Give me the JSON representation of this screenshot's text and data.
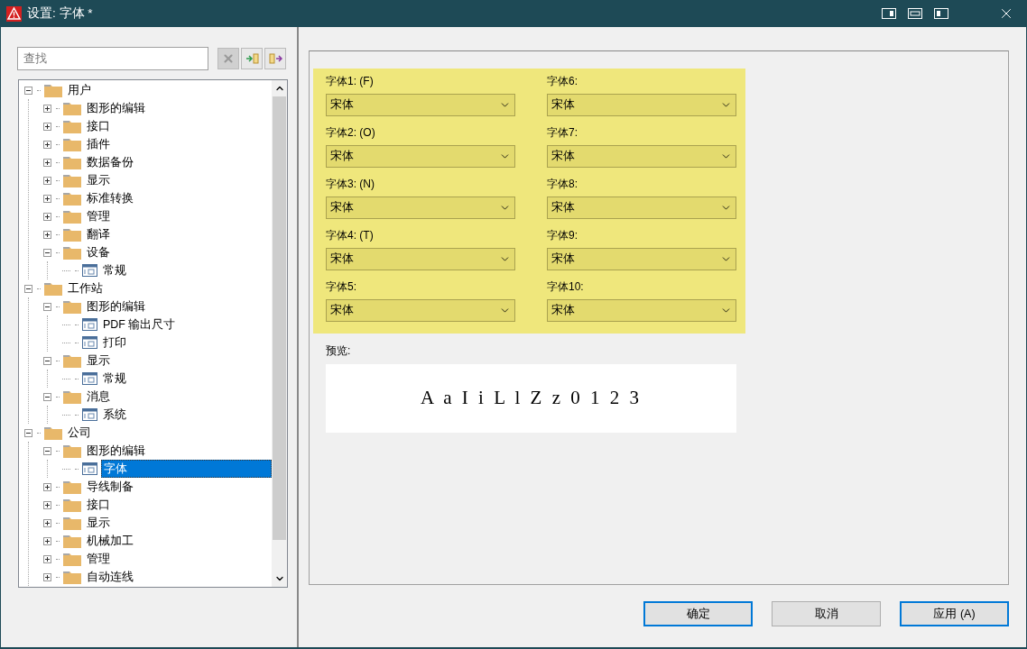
{
  "window": {
    "title": "设置: 字体 *"
  },
  "search": {
    "placeholder": "查找"
  },
  "tree": [
    {
      "label": "用户",
      "kind": "folder",
      "expanded": true,
      "selected": false,
      "children": [
        {
          "label": "图形的编辑",
          "kind": "folder",
          "expanded": false,
          "selected": false
        },
        {
          "label": "接口",
          "kind": "folder",
          "expanded": false,
          "selected": false
        },
        {
          "label": "插件",
          "kind": "folder",
          "expanded": false,
          "selected": false
        },
        {
          "label": "数据备份",
          "kind": "folder",
          "expanded": false,
          "selected": false
        },
        {
          "label": "显示",
          "kind": "folder",
          "expanded": false,
          "selected": false
        },
        {
          "label": "标准转换",
          "kind": "folder",
          "expanded": false,
          "selected": false
        },
        {
          "label": "管理",
          "kind": "folder",
          "expanded": false,
          "selected": false
        },
        {
          "label": "翻译",
          "kind": "folder",
          "expanded": false,
          "selected": false
        },
        {
          "label": "设备",
          "kind": "folder",
          "expanded": true,
          "selected": false,
          "children": [
            {
              "label": "常规",
              "kind": "page",
              "selected": false
            }
          ]
        }
      ]
    },
    {
      "label": "工作站",
      "kind": "folder",
      "expanded": true,
      "selected": false,
      "children": [
        {
          "label": "图形的编辑",
          "kind": "folder",
          "expanded": true,
          "selected": false,
          "children": [
            {
              "label": "PDF 输出尺寸",
              "kind": "page",
              "selected": false
            },
            {
              "label": "打印",
              "kind": "page",
              "selected": false
            }
          ]
        },
        {
          "label": "显示",
          "kind": "folder",
          "expanded": true,
          "selected": false,
          "children": [
            {
              "label": "常规",
              "kind": "page",
              "selected": false
            }
          ]
        },
        {
          "label": "消息",
          "kind": "folder",
          "expanded": true,
          "selected": false,
          "children": [
            {
              "label": "系统",
              "kind": "page",
              "selected": false
            }
          ]
        }
      ]
    },
    {
      "label": "公司",
      "kind": "folder",
      "expanded": true,
      "selected": false,
      "children": [
        {
          "label": "图形的编辑",
          "kind": "folder",
          "expanded": true,
          "selected": false,
          "children": [
            {
              "label": "字体",
              "kind": "page",
              "selected": true
            }
          ]
        },
        {
          "label": "导线制备",
          "kind": "folder",
          "expanded": false,
          "selected": false
        },
        {
          "label": "接口",
          "kind": "folder",
          "expanded": false,
          "selected": false
        },
        {
          "label": "显示",
          "kind": "folder",
          "expanded": false,
          "selected": false
        },
        {
          "label": "机械加工",
          "kind": "folder",
          "expanded": false,
          "selected": false
        },
        {
          "label": "管理",
          "kind": "folder",
          "expanded": false,
          "selected": false
        },
        {
          "label": "自动连线",
          "kind": "folder",
          "expanded": false,
          "selected": false
        }
      ]
    }
  ],
  "fonts": [
    {
      "label": "字体1: (F)",
      "value": "宋体"
    },
    {
      "label": "字体2: (O)",
      "value": "宋体"
    },
    {
      "label": "字体3: (N)",
      "value": "宋体"
    },
    {
      "label": "字体4: (T)",
      "value": "宋体"
    },
    {
      "label": "字体5:",
      "value": "宋体"
    },
    {
      "label": "字体6:",
      "value": "宋体"
    },
    {
      "label": "字体7:",
      "value": "宋体"
    },
    {
      "label": "字体8:",
      "value": "宋体"
    },
    {
      "label": "字体9:",
      "value": "宋体"
    },
    {
      "label": "字体10:",
      "value": "宋体"
    }
  ],
  "preview": {
    "label": "预览:",
    "sample": "A a I i L l Z z 0 1 2 3"
  },
  "buttons": [
    {
      "label": "确定",
      "default": true
    },
    {
      "label": "取消",
      "default": false
    },
    {
      "label": "应用 (A)",
      "default": true
    }
  ]
}
